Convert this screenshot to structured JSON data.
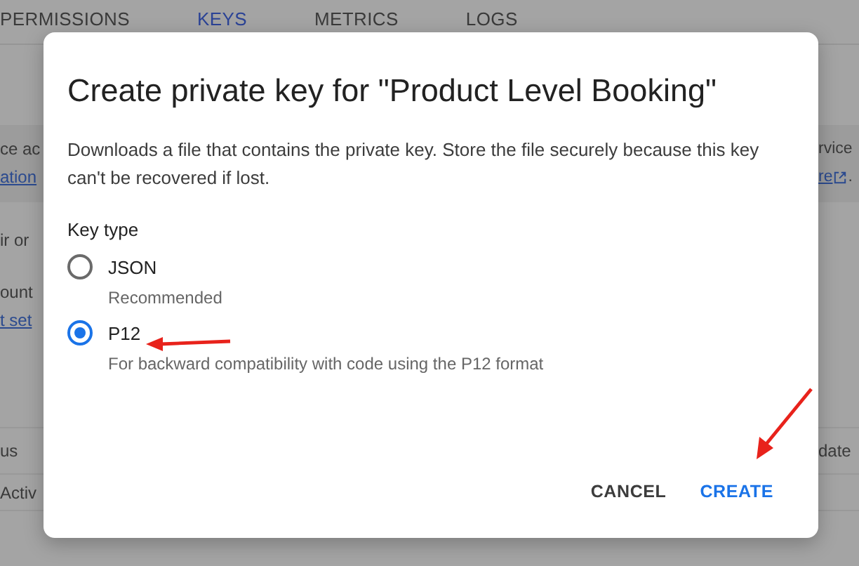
{
  "tabs": [
    {
      "label": "PERMISSIONS",
      "selected": false
    },
    {
      "label": "KEYS",
      "selected": true
    },
    {
      "label": "METRICS",
      "selected": false
    },
    {
      "label": "LOGS",
      "selected": false
    }
  ],
  "background": {
    "left_band": [
      {
        "text": "ce ac",
        "kind": "text"
      },
      {
        "text": "ation",
        "kind": "link"
      }
    ],
    "left_lines": [
      {
        "text": "ir or",
        "kind": "text"
      }
    ],
    "left_block": [
      {
        "text": "ount",
        "kind": "text"
      },
      {
        "text": "t set",
        "kind": "link"
      }
    ],
    "right_band": [
      {
        "text": "rvice",
        "kind": "text"
      },
      {
        "text": "re",
        "kind": "external_link",
        "after": "."
      }
    ],
    "table": {
      "columns": [
        {
          "left": "us",
          "right": "date"
        }
      ],
      "rows": [
        {
          "left": "Activ"
        }
      ]
    }
  },
  "dialog": {
    "title": "Create private key for \"Product Level Booking\"",
    "description": "Downloads a file that contains the private key. Store the file securely because this key can't be recovered if lost.",
    "group_label": "Key type",
    "options": [
      {
        "label": "JSON",
        "hint": "Recommended",
        "selected": false
      },
      {
        "label": "P12",
        "hint": "For backward compatibility with code using the P12 format",
        "selected": true
      }
    ],
    "buttons": [
      {
        "label": "CANCEL",
        "kind": "secondary"
      },
      {
        "label": "CREATE",
        "kind": "primary"
      }
    ]
  }
}
